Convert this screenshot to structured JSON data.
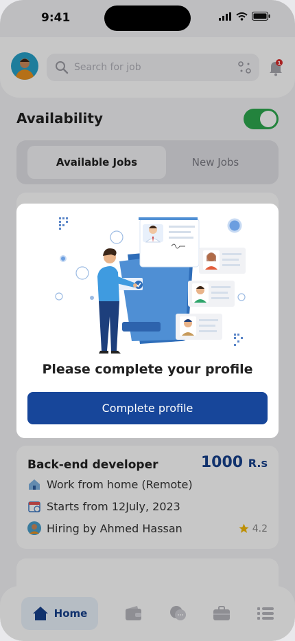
{
  "status_bar": {
    "time": "9:41"
  },
  "header": {
    "search_placeholder": "Search for job",
    "notification_count": "1"
  },
  "availability": {
    "title": "Availability",
    "enabled": true
  },
  "tabs": [
    {
      "label": "Available Jobs",
      "active": true
    },
    {
      "label": "New Jobs",
      "active": false
    }
  ],
  "job": {
    "title": "Back-end developer",
    "salary_amount": "1000",
    "salary_unit": "R.s",
    "location": "Work from home (Remote)",
    "start": "Starts from 12July, 2023",
    "hiring": "Hiring by Ahmed Hassan",
    "rating": "4.2"
  },
  "modal": {
    "message": "Please complete your profile",
    "button_label": "Complete profile"
  },
  "bottom_nav": {
    "home_label": "Home"
  },
  "colors": {
    "brand": "#17469a",
    "toggle_on": "#2ea84f",
    "star": "#f2b807",
    "badge": "#d92c2c"
  }
}
